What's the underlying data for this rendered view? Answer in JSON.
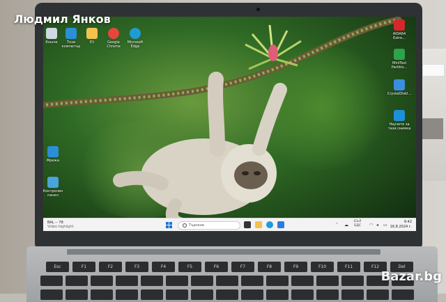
{
  "caption": "Людмил Янков",
  "watermark": "Bazar.bg",
  "desktop_icons_left": [
    {
      "icon": "recycle-bin-icon",
      "label": "Кошче",
      "color": "#cfd8e3"
    },
    {
      "icon": "this-pc-icon",
      "label": "Този компютър",
      "color": "#2a8fd6"
    },
    {
      "icon": "folder-icon",
      "label": "Eli",
      "color": "#f2c14e"
    },
    {
      "icon": "chrome-icon",
      "label": "Google Chrome",
      "color": "#e8453c"
    },
    {
      "icon": "edge-icon",
      "label": "Microsoft Edge",
      "color": "#1f9bd6"
    }
  ],
  "desktop_icons_mid": [
    {
      "icon": "network-icon",
      "label": "Мрежа",
      "color": "#2a8fd6"
    },
    {
      "icon": "control-panel-icon",
      "label": "Контролен панел",
      "color": "#4aa3d9"
    }
  ],
  "desktop_icons_right": [
    {
      "icon": "aida64-icon",
      "label": "AIDA64 Extre...",
      "color": "#d6272c"
    },
    {
      "icon": "mintool-icon",
      "label": "MiniTool Partitio...",
      "color": "#2fa34a"
    },
    {
      "icon": "crystaldisk-icon",
      "label": "CrystalDiskI...",
      "color": "#3b8ede"
    },
    {
      "icon": "getting-started-icon",
      "label": "Научете за тази снимка",
      "color": "#1e90d6"
    }
  ],
  "taskbar": {
    "weather_temp": "BAL -- 78",
    "weather_sub": "Video highlight",
    "search_placeholder": "Търсене",
    "tray_label": "БЪЛ",
    "tray_sub": "БДС",
    "time": "9:42",
    "date": "16.8.2024 г."
  },
  "keyboard_keys": [
    "Esc",
    "F1",
    "F2",
    "F3",
    "F4",
    "F5",
    "F6",
    "F7",
    "F8",
    "F9",
    "F10",
    "F11",
    "F12",
    "Del"
  ]
}
